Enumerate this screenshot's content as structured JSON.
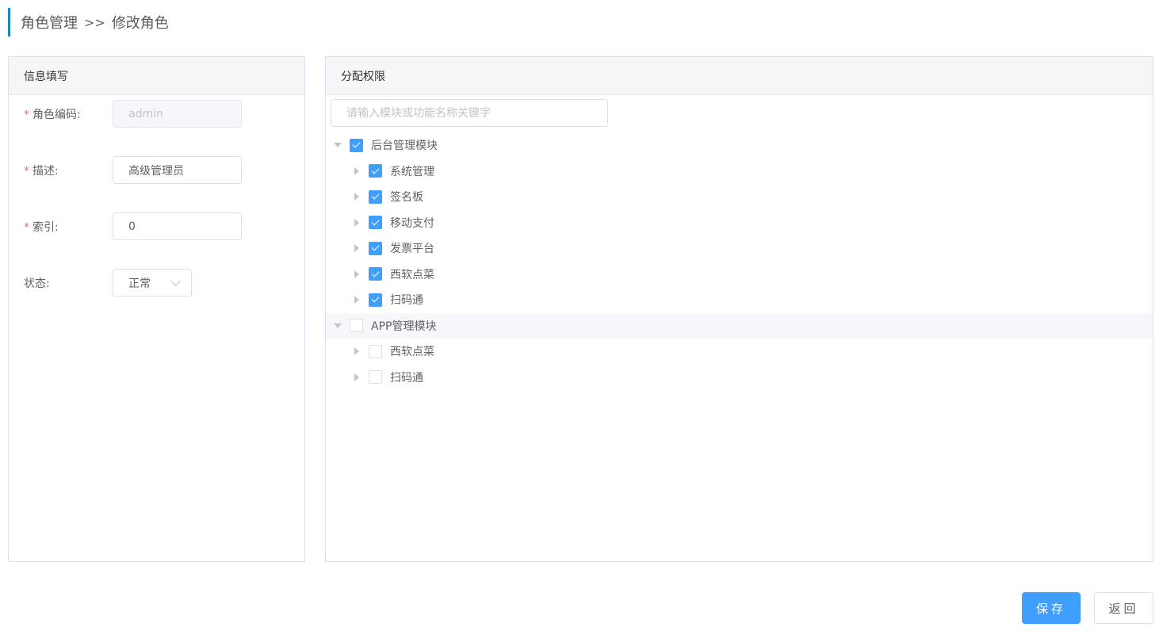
{
  "breadcrumb": {
    "parent": "角色管理",
    "separator": ">>",
    "current": "修改角色"
  },
  "info_panel": {
    "title": "信息填写",
    "role_code": {
      "label": "角色编码:",
      "value": "admin",
      "required": true
    },
    "description": {
      "label": "描述:",
      "value": "高级管理员",
      "required": true
    },
    "index": {
      "label": "索引:",
      "value": "0",
      "required": true
    },
    "status": {
      "label": "状态:",
      "value": "正常"
    }
  },
  "perm_panel": {
    "title": "分配权限",
    "filter_placeholder": "请输入模块或功能名称关键字",
    "tree": [
      {
        "label": "后台管理模块",
        "checked": true,
        "expanded": true,
        "children": [
          {
            "label": "系统管理",
            "checked": true
          },
          {
            "label": "签名板",
            "checked": true
          },
          {
            "label": "移动支付",
            "checked": true
          },
          {
            "label": "发票平台",
            "checked": true
          },
          {
            "label": "西软点菜",
            "checked": true
          },
          {
            "label": "扫码通",
            "checked": true
          }
        ]
      },
      {
        "label": "APP管理模块",
        "checked": false,
        "expanded": true,
        "children": [
          {
            "label": "西软点菜",
            "checked": false
          },
          {
            "label": "扫码通",
            "checked": false
          }
        ]
      }
    ]
  },
  "actions": {
    "save": "保存",
    "back": "返回"
  },
  "colors": {
    "accent": "#409eff",
    "breadcrumb_bar": "#1a8bbf",
    "required": "#f56c6c"
  }
}
